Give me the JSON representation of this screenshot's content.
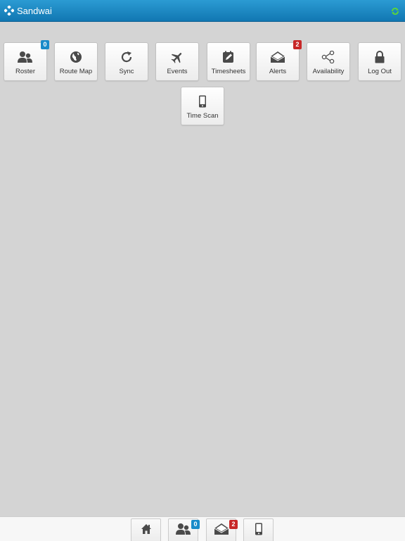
{
  "header": {
    "title": "Sandwai",
    "logo_icon": "sandwai-logo-icon",
    "status_icon": "sync-status-icon",
    "accent_color": "#1a8bc9"
  },
  "tiles": [
    {
      "label": "Roster",
      "icon": "users-icon",
      "badge": "0",
      "badge_color": "#1a8bc9"
    },
    {
      "label": "Route Map",
      "icon": "globe-icon"
    },
    {
      "label": "Sync",
      "icon": "refresh-icon"
    },
    {
      "label": "Events",
      "icon": "airplane-icon"
    },
    {
      "label": "Timesheets",
      "icon": "edit-icon"
    },
    {
      "label": "Alerts",
      "icon": "envelope-open-icon",
      "badge": "2",
      "badge_color": "#c82828"
    },
    {
      "label": "Availability",
      "icon": "share-icon"
    },
    {
      "label": "Log Out",
      "icon": "lock-icon"
    },
    {
      "label": "Time Scan",
      "icon": "mobile-phone-icon"
    }
  ],
  "bottom_nav": [
    {
      "icon": "home-icon"
    },
    {
      "icon": "users-icon",
      "badge": "0",
      "badge_color": "#1a8bc9"
    },
    {
      "icon": "envelope-open-icon",
      "badge": "2",
      "badge_color": "#c82828"
    },
    {
      "icon": "mobile-phone-icon"
    }
  ]
}
